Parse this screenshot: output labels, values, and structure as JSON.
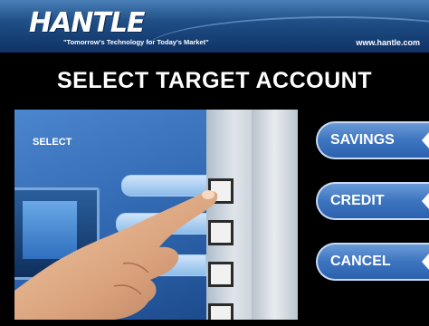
{
  "header": {
    "logo_text": "HANTLE",
    "tagline": "\"Tomorrow's Technology for Today's Market\"",
    "url": "www.hantle.com",
    "colors": {
      "banner_top": "#4a7fb8",
      "banner_bottom": "#0f3266"
    }
  },
  "title": "SELECT TARGET ACCOUNT",
  "photo": {
    "screen_text": "SELECT"
  },
  "buttons": [
    {
      "label": "SAVINGS"
    },
    {
      "label": "CREDIT"
    },
    {
      "label": "CANCEL"
    }
  ],
  "colors": {
    "background": "#000000",
    "button": "#3d74bf",
    "button_border": "#c7dcf4"
  }
}
